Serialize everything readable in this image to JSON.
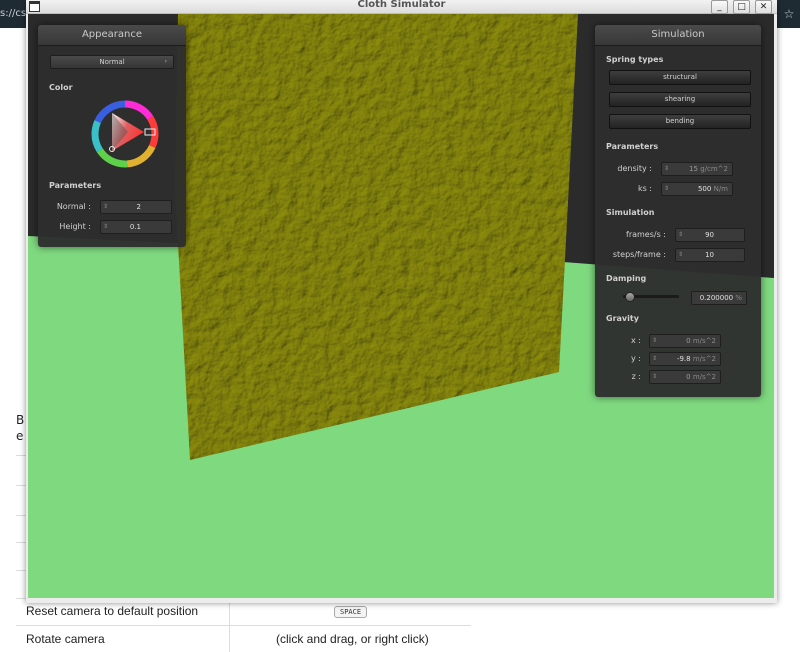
{
  "browser": {
    "url_fragment": "s://cs",
    "doc_left_fragment_1": "B",
    "doc_left_fragment_2": "e",
    "rows": [
      {
        "action": "Reset camera to default position",
        "key": "SPACE"
      },
      {
        "action": "Rotate camera",
        "key": "(click and drag, or right click)"
      }
    ]
  },
  "window": {
    "title": "Cloth Simulator",
    "controls": {
      "minimize": "_",
      "maximize": "□",
      "close": "✕"
    }
  },
  "appearance": {
    "title": "Appearance",
    "shader_select": "Normal",
    "color_label": "Color",
    "parameters_label": "Parameters",
    "normal_label": "Normal :",
    "normal_value": "2",
    "height_label": "Height :",
    "height_value": "0.1"
  },
  "simulation": {
    "title": "Simulation",
    "spring_types_label": "Spring types",
    "springs": [
      "structural",
      "shearing",
      "bending"
    ],
    "parameters_label": "Parameters",
    "density_label": "density :",
    "density_value": "15",
    "density_unit": "g/cm^2",
    "ks_label": "ks :",
    "ks_value": "500",
    "ks_unit": "N/m",
    "simulation_label": "Simulation",
    "fps_label": "frames/s :",
    "fps_value": "90",
    "steps_label": "steps/frame :",
    "steps_value": "10",
    "damping_label": "Damping",
    "damping_value": "0.200000",
    "damping_unit": "%",
    "damping_level": 0.02,
    "gravity_label": "Gravity",
    "gx_label": "x :",
    "gx_value": "0",
    "gy_label": "y :",
    "gy_value": "-9.8",
    "gz_label": "z :",
    "gz_value": "0",
    "gravity_unit": "m/s^2"
  },
  "colors": {
    "floor": "#7fd97f",
    "cloth": "#8a8a10",
    "panel": "#2e2e2e"
  }
}
